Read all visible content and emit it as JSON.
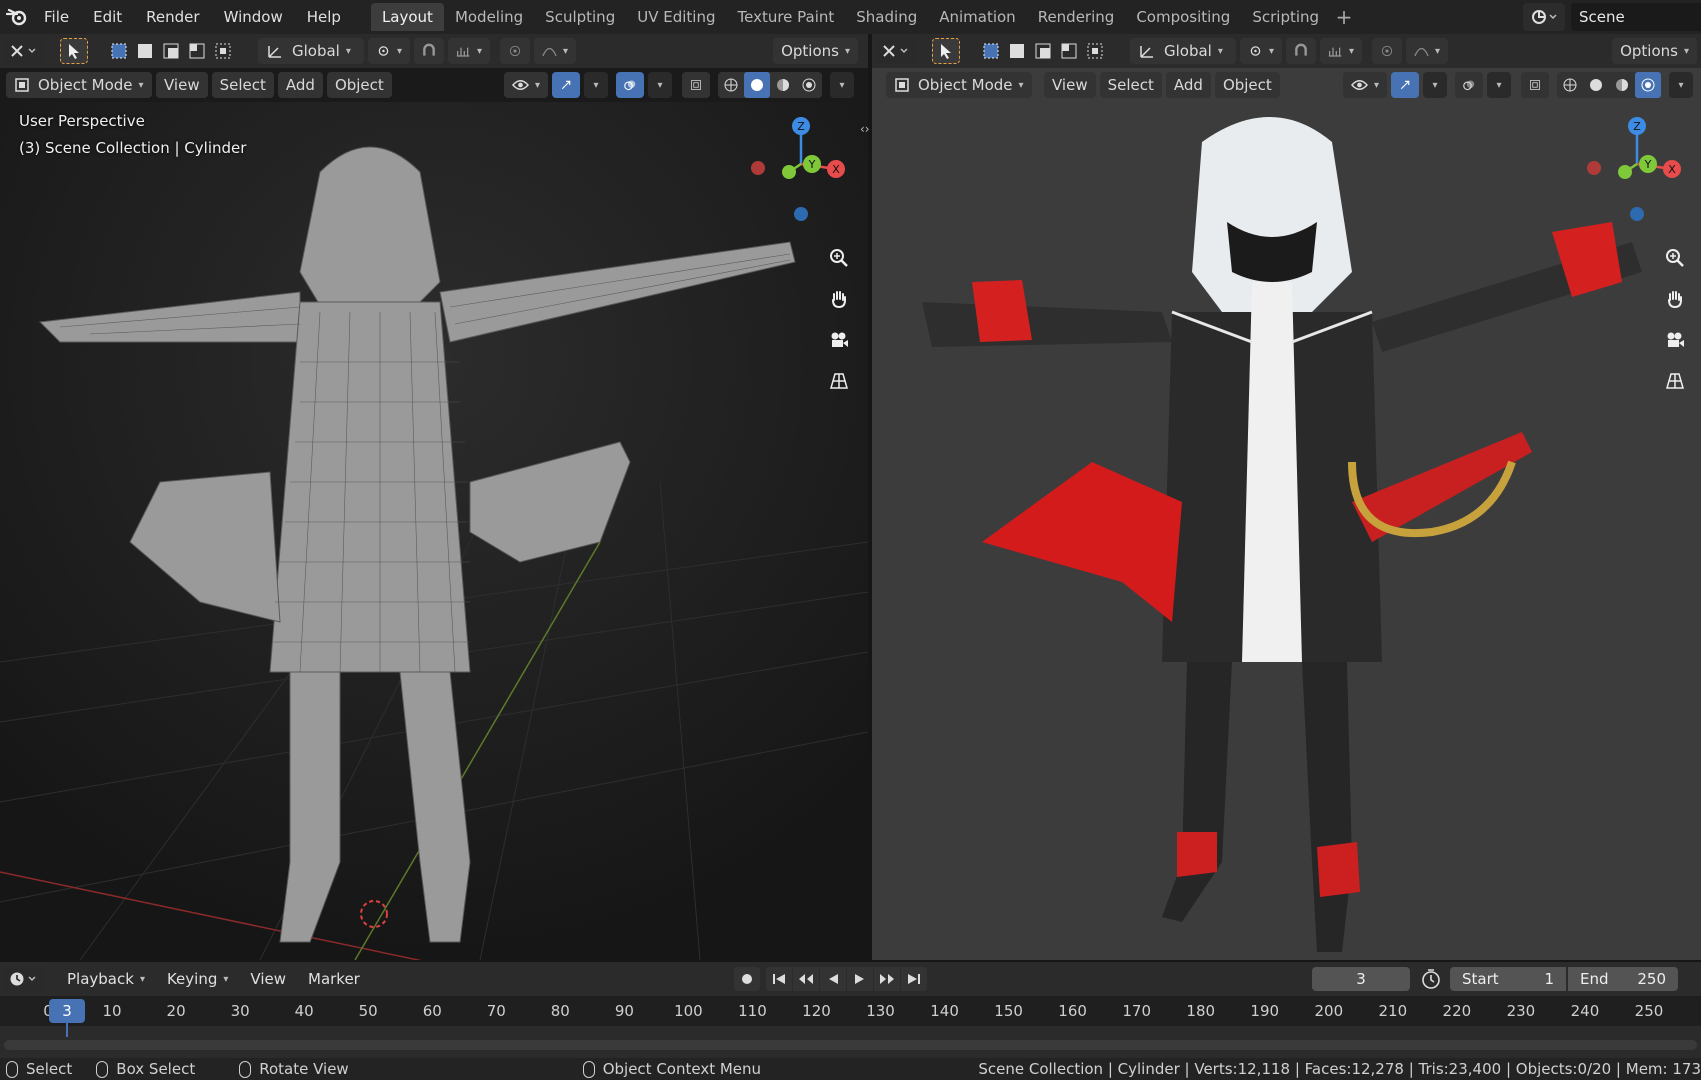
{
  "topbar": {
    "menus": [
      "File",
      "Edit",
      "Render",
      "Window",
      "Help"
    ],
    "workspaces": [
      "Layout",
      "Modeling",
      "Sculpting",
      "UV Editing",
      "Texture Paint",
      "Shading",
      "Animation",
      "Rendering",
      "Compositing",
      "Scripting"
    ],
    "active_workspace": "Layout",
    "scene_name": "Scene"
  },
  "viewport_left": {
    "transform_orientation": "Global",
    "options_label": "Options",
    "mode_label": "Object Mode",
    "menus": [
      "View",
      "Select",
      "Add",
      "Object"
    ],
    "perspective_label": "User Perspective",
    "collection_label": "(3) Scene Collection | Cylinder",
    "gizmo": {
      "z": "Z",
      "y": "Y",
      "x": "X"
    }
  },
  "viewport_right": {
    "transform_orientation": "Global",
    "options_label": "Options",
    "mode_label": "Object Mode",
    "menus": [
      "View",
      "Select",
      "Add",
      "Object"
    ],
    "gizmo": {
      "z": "Z",
      "y": "Y",
      "x": "X"
    }
  },
  "timeline": {
    "menus": [
      "Playback",
      "Keying",
      "View",
      "Marker"
    ],
    "current_frame": "3",
    "start_label": "Start",
    "start_value": "1",
    "end_label": "End",
    "end_value": "250",
    "ruler_start": "0",
    "ticks": [
      "10",
      "20",
      "30",
      "40",
      "50",
      "60",
      "70",
      "80",
      "90",
      "100",
      "110",
      "120",
      "130",
      "140",
      "150",
      "160",
      "170",
      "180",
      "190",
      "200",
      "210",
      "220",
      "230",
      "240",
      "250"
    ]
  },
  "statusbar": {
    "select": "Select",
    "box_select": "Box Select",
    "rotate_view": "Rotate View",
    "context_menu": "Object Context Menu",
    "stats": "Scene Collection | Cylinder | Verts:12,118 | Faces:12,278 | Tris:23,400 | Objects:0/20 | Mem: 173"
  },
  "colors": {
    "accent": "#4772b3",
    "axis_x": "#e84b4b",
    "axis_y": "#7ec83a",
    "axis_z": "#3d8ce4"
  }
}
